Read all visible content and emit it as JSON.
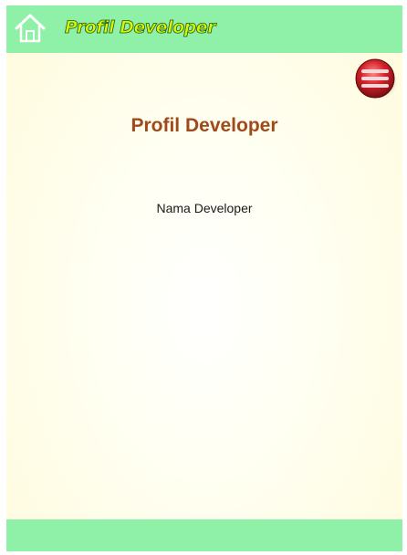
{
  "header": {
    "title": "Profil Developer",
    "home_icon": "home-icon",
    "background_color": "#8ff0a8"
  },
  "main": {
    "menu_icon": "menu-icon",
    "page_title": "Profil Developer",
    "developer_name": "Nama Developer"
  },
  "footer": {
    "background_color": "#8ff0a8"
  },
  "colors": {
    "title_text": "#a04a1c",
    "header_title_fill": "#d6f60a",
    "menu_button_red": "#c8161c"
  }
}
